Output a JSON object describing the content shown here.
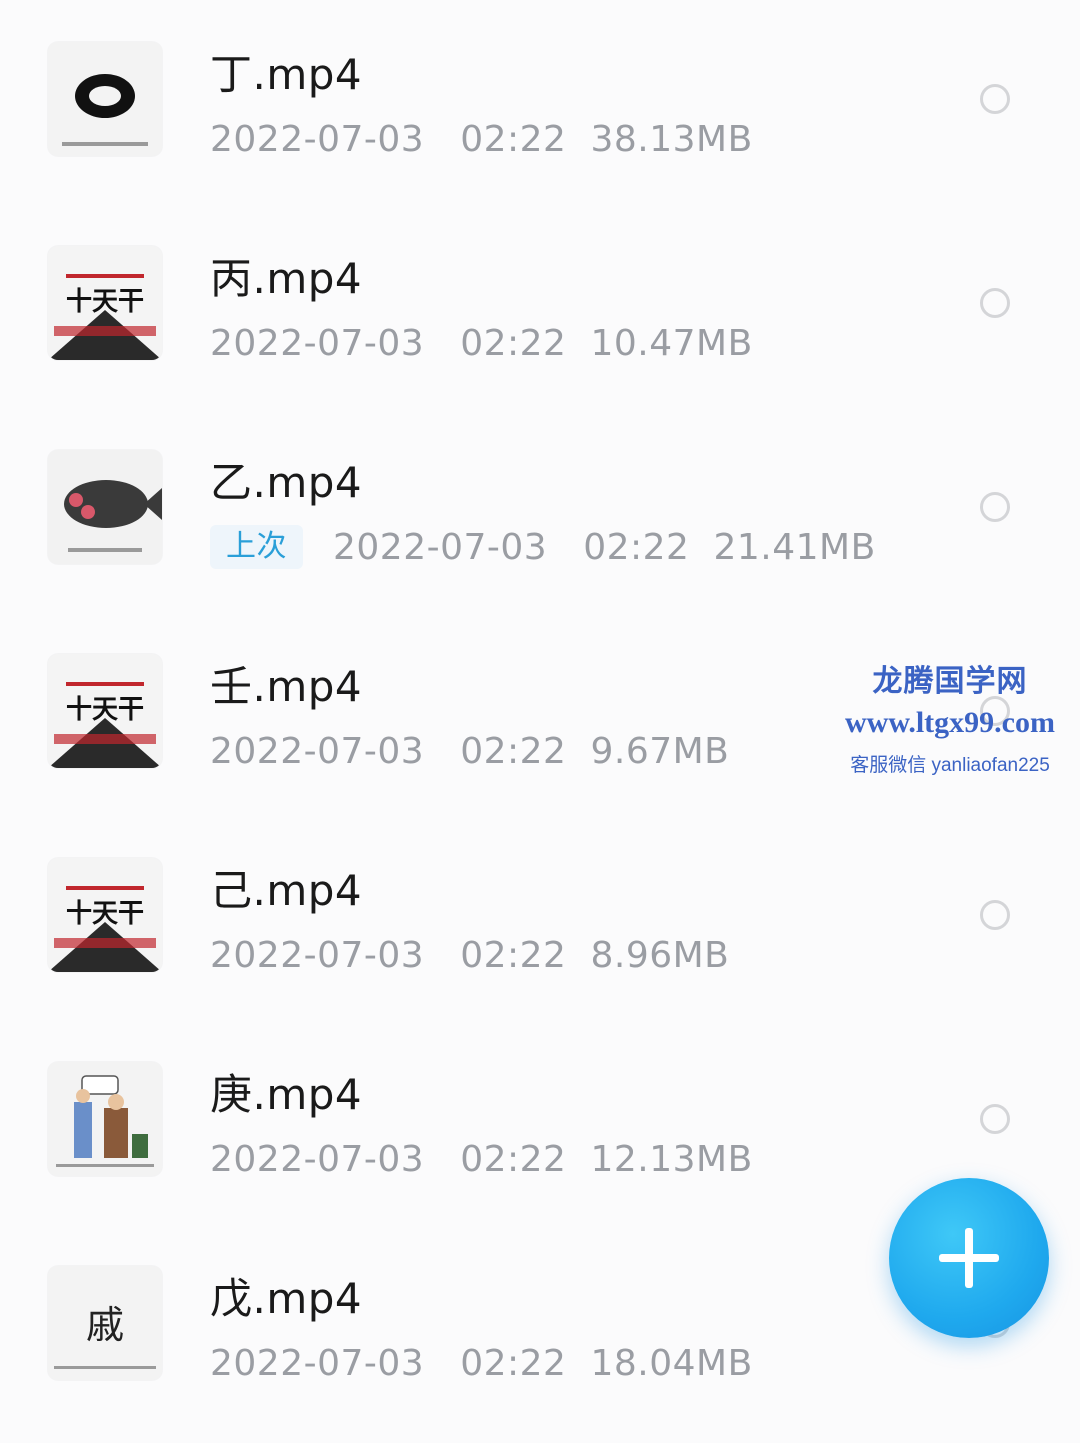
{
  "files": [
    {
      "name": "丁.mp4",
      "badge": "",
      "date": "2022-07-03",
      "time": "02:22",
      "size": "38.13MB",
      "thumb": "ink-circle"
    },
    {
      "name": "丙.mp4",
      "badge": "",
      "date": "2022-07-03",
      "time": "02:22",
      "size": "10.47MB",
      "thumb": "ten-stems-title",
      "thumb_text": "十天干"
    },
    {
      "name": "乙.mp4",
      "badge": "上次",
      "date": "2022-07-03",
      "time": "02:22",
      "size": "21.41MB",
      "thumb": "fish-ink"
    },
    {
      "name": "壬.mp4",
      "badge": "",
      "date": "2022-07-03",
      "time": "02:22",
      "size": "9.67MB",
      "thumb": "ten-stems-title",
      "thumb_text": "十天干"
    },
    {
      "name": "己.mp4",
      "badge": "",
      "date": "2022-07-03",
      "time": "02:22",
      "size": "8.96MB",
      "thumb": "ten-stems-title",
      "thumb_text": "十天干"
    },
    {
      "name": "庚.mp4",
      "badge": "",
      "date": "2022-07-03",
      "time": "02:22",
      "size": "12.13MB",
      "thumb": "figures-illustration"
    },
    {
      "name": "戊.mp4",
      "badge": "",
      "date": "2022-07-03",
      "time": "02:22",
      "size": "18.04MB",
      "thumb": "character-card",
      "thumb_text": "戚"
    }
  ],
  "fab": {
    "icon": "plus-icon",
    "color": "#1fa9ee"
  },
  "watermark": {
    "title": "龙腾国学网",
    "url": "www.ltgx99.com",
    "contact": "客服微信 yanliaofan225"
  }
}
